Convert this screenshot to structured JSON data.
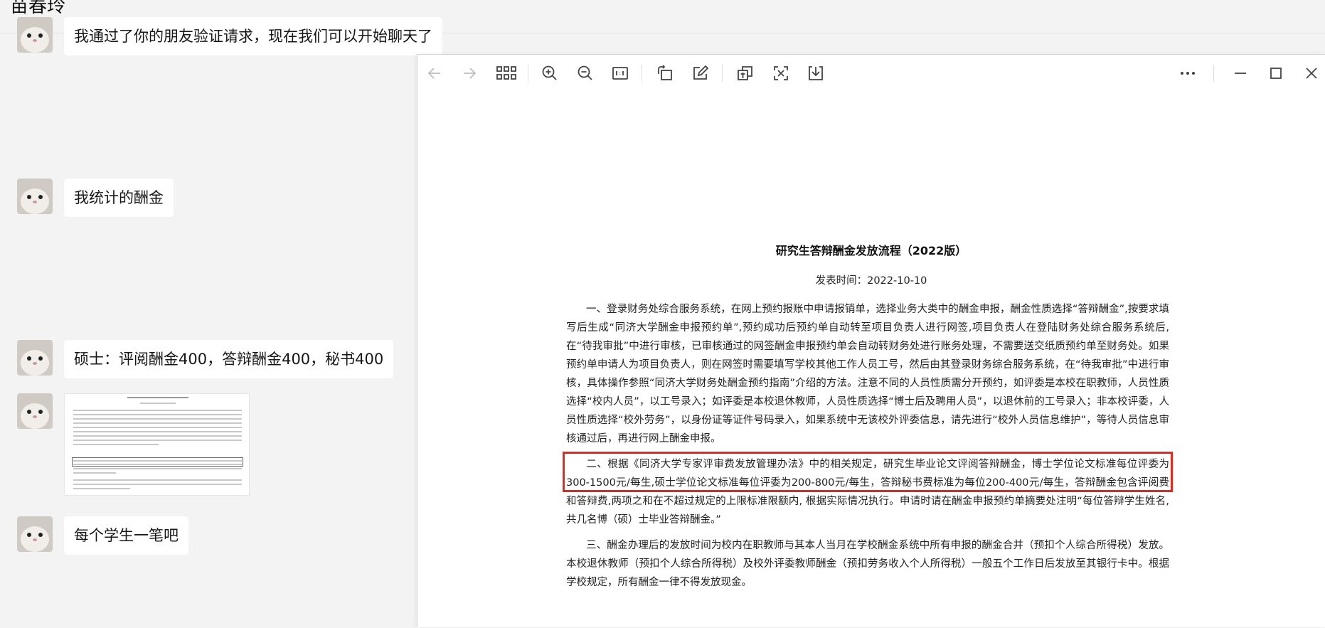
{
  "chat": {
    "title": "苗春玲",
    "messages": [
      {
        "text": "我通过了你的朋友验证请求，现在我们可以开始聊天了"
      },
      {
        "text": "我统计的酬金"
      },
      {
        "text": "硕士：评阅酬金400，答辩酬金400，秘书400"
      },
      {
        "type": "image"
      },
      {
        "text": "每个学生一笔吧"
      }
    ]
  },
  "viewer": {
    "toolbar": {
      "back": "back-arrow-icon",
      "forward": "forward-arrow-icon",
      "grid": "grid-icon",
      "zoom_in": "zoom-in-icon",
      "zoom_out": "zoom-out-icon",
      "actual_size": "actual-size-icon",
      "rotate": "rotate-icon",
      "edit": "edit-icon",
      "translate": "translate-icon",
      "extract_text": "extract-text-icon",
      "download": "download-icon",
      "more": "more-icon",
      "minimize": "minimize-icon",
      "maximize": "maximize-icon",
      "close": "close-icon"
    },
    "document": {
      "title": "研究生答辩酬金发放流程（2022版）",
      "date": "发表时间：2022-10-10",
      "paragraphs": [
        "一、登录财务处综合服务系统，在网上预约报账中申请报销单，选择业务大类中的酬金申报，酬金性质选择“答辩酬金”,按要求填写后生成“同济大学酬金申报预约单”,预约成功后预约单自动转至项目负责人进行网签,项目负责人在登陆财务处综合服务系统后,在“待我审批”中进行审核，已审核通过的网签酬金申报预约单会自动转财务处进行账务处理，不需要送交纸质预约单至财务处。如果预约单申请人为项目负责人，则在网签时需要填写学校其他工作人员工号，然后由其登录财务综合服务系统，在“待我审批”中进行审核，具体操作参照“同济大学财务处酬金预约指南”介绍的方法。注意不同的人员性质需分开预约，如评委是本校在职教师，人员性质选择“校内人员”，以工号录入；如评委是本校退休教师，人员性质选择“博士后及聘用人员”，以退休前的工号录入；非本校评委，人员性质选择“校外劳务”，以身份证等证件号码录入，如果系统中无该校外评委信息，请先进行“校外人员信息维护”，等待人员信息审核通过后，再进行网上酬金申报。",
        "二、根据《同济大学专家评审费发放管理办法》中的相关规定，研究生毕业论文评阅答辩酬金，博士学位论文标准每位评委为300-1500元/每生,硕士学位论文标准每位评委为200-800元/每生，答辩秘书费标准为每位200-400元/每生，答辩酬金包含评阅费和答辩费,两项之和在不超过规定的上限标准限额内, 根据实际情况执行。申请时请在酬金申报预约单摘要处注明“每位答辩学生姓名,共几名博（硕）士毕业答辩酬金。”",
        "三、酬金办理后的发放时间为校内在职教师与其本人当月在学校酬金系统中所有申报的酬金合并（预扣个人综合所得税）发放。本校退休教师（预扣个人综合所得税）及校外评委教师酬金（预扣劳务收入个人所得税）一般五个工作日后发放至其银行卡中。根据学校规定，所有酬金一律不得发放现金。"
      ]
    }
  }
}
